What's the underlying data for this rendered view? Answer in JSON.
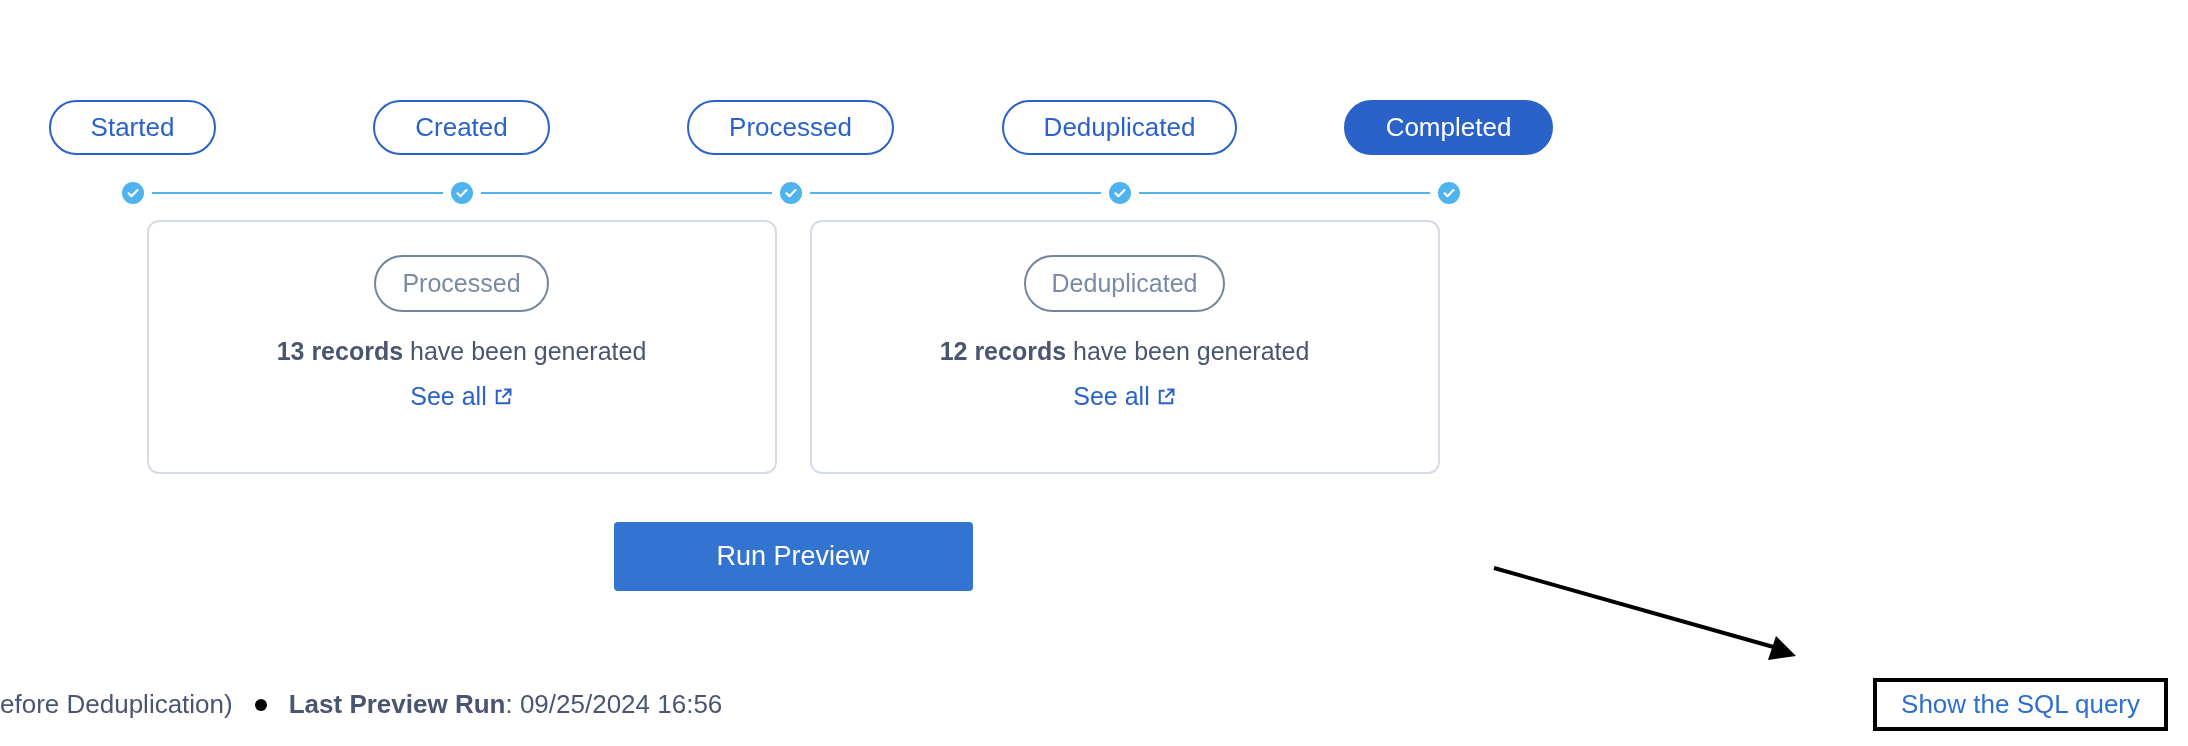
{
  "steps": [
    {
      "label": "Started",
      "selected": false,
      "done": true
    },
    {
      "label": "Created",
      "selected": false,
      "done": true
    },
    {
      "label": "Processed",
      "selected": false,
      "done": true
    },
    {
      "label": "Deduplicated",
      "selected": false,
      "done": true
    },
    {
      "label": "Completed",
      "selected": true,
      "done": true
    }
  ],
  "cards": [
    {
      "stage": "Processed",
      "summary": "**13 records** have been generated",
      "link": "See all"
    },
    {
      "stage": "Deduplicated",
      "summary": "**12 records** have been generated",
      "link": "See all"
    }
  ],
  "run_button": "Run Preview",
  "footer": {
    "note": "efore Deduplication)",
    "last_run": "**Last Preview Run**: 09/25/2024 16:56"
  },
  "sql_link": "Show the SQL query"
}
